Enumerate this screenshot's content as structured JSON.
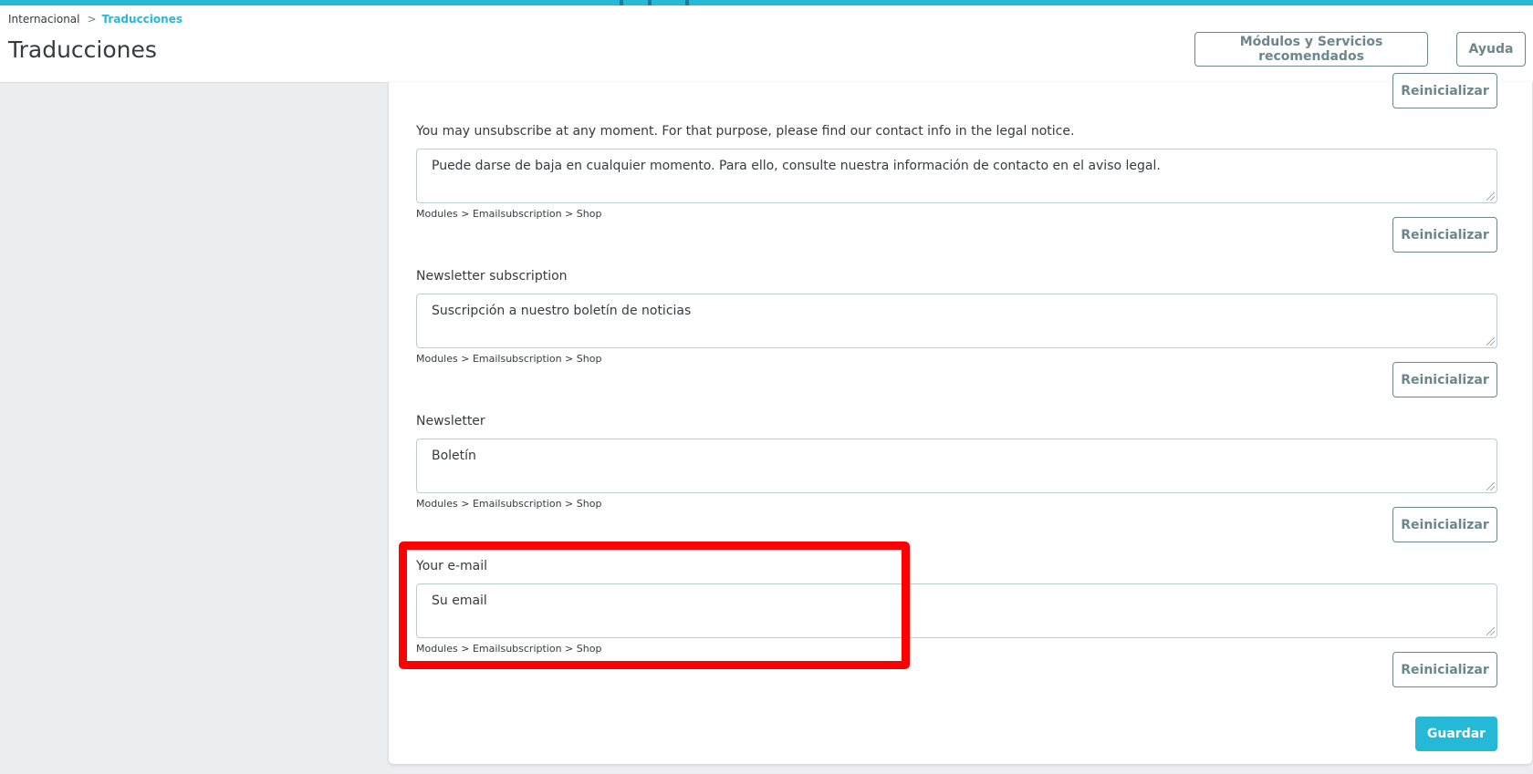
{
  "header": {
    "breadcrumb": {
      "parent": "Internacional",
      "separator": ">",
      "current": "Traducciones"
    },
    "title": "Traducciones",
    "buttons": {
      "recommended": "Módulos y Servicios recomendados",
      "help": "Ayuda"
    }
  },
  "colors": {
    "accent": "#25b9d7",
    "highlight": "#ff0000",
    "text": "#363a41",
    "muted": "#6c868e"
  },
  "translations": {
    "reset_label": "Reinicializar",
    "save_label": "Guardar",
    "items": [
      {
        "source": "You may unsubscribe at any moment. For that purpose, please find our contact info in the legal notice.",
        "value": "Puede darse de baja en cualquier momento. Para ello, consulte nuestra información de contacto en el aviso legal.",
        "path": "Modules > Emailsubscription > Shop"
      },
      {
        "source": "Newsletter subscription",
        "value": "Suscripción a nuestro boletín de noticias",
        "path": "Modules > Emailsubscription > Shop"
      },
      {
        "source": "Newsletter",
        "value": "Boletín",
        "path": "Modules > Emailsubscription > Shop"
      },
      {
        "source": "Your e-mail",
        "value": "Su email",
        "path": "Modules > Emailsubscription > Shop"
      }
    ]
  }
}
